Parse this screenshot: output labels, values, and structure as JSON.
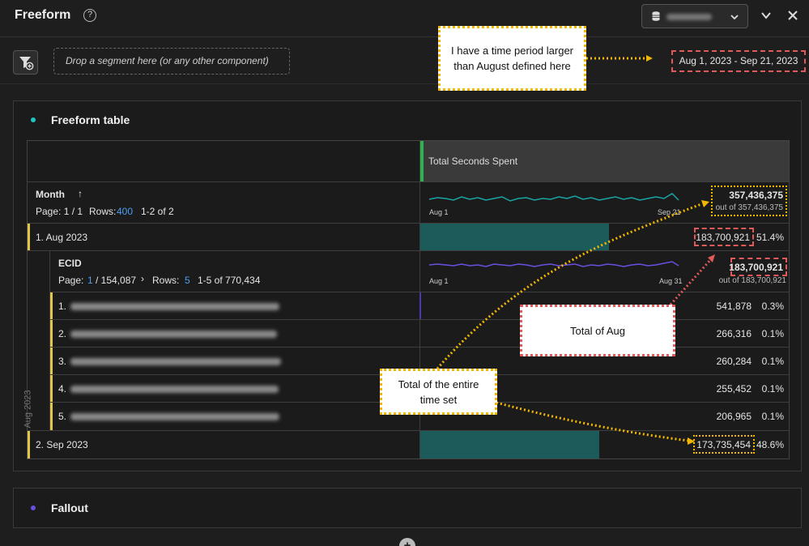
{
  "header": {
    "title": "Freeform",
    "help_icon": "?",
    "chevron_down": "⌄",
    "close": "✕"
  },
  "segment_bar": {
    "drop_placeholder": "Drop a segment here (or any other component)",
    "date_range": "Aug 1, 2023 - Sep 21, 2023"
  },
  "callouts": {
    "time_period": "I have a time period larger than August defined here",
    "total_aug": "Total of Aug",
    "total_entire": "Total of the entire time set"
  },
  "colors": {
    "accent_teal": "#21c3c3",
    "accent_purple": "#6b4fe0",
    "highlight_yellow": "#f2b700",
    "highlight_red": "#e05a5a"
  },
  "panel": {
    "title": "Freeform table",
    "metric_header": "Total Seconds Spent",
    "dimension": "Month",
    "sort_icon": "↑",
    "page_label": "Page: 1 / 1",
    "rows_label": "Rows:",
    "rows_value": "400",
    "range_label": "1-2 of 2",
    "spark_start": "Aug 1",
    "spark_end": "Sep 21",
    "grand_total": "357,436,375",
    "grand_total_sub": "out of 357,436,375",
    "aug_label": "1.  Aug 2023",
    "aug_value": "183,700,921",
    "aug_pct": "51.4%",
    "breakdown": {
      "dimension": "ECID",
      "page_prefix": "Page:",
      "page_current": "1",
      "page_total": "/ 154,087",
      "next_icon": "›",
      "rows_label": "Rows:",
      "rows_value": "5",
      "range_label": "1-5 of 770,434",
      "spark_start": "Aug 1",
      "spark_end": "Aug 31",
      "total": "183,700,921",
      "total_sub": "out of 183,700,921",
      "side_label": "Aug 2023",
      "rows": [
        {
          "idx": "1.",
          "value": "541,878",
          "pct": "0.3%"
        },
        {
          "idx": "2.",
          "value": "266,316",
          "pct": "0.1%"
        },
        {
          "idx": "3.",
          "value": "260,284",
          "pct": "0.1%"
        },
        {
          "idx": "4.",
          "value": "255,452",
          "pct": "0.1%"
        },
        {
          "idx": "5.",
          "value": "206,965",
          "pct": "0.1%"
        }
      ]
    },
    "sep_label": "2.  Sep 2023",
    "sep_value": "173,735,454",
    "sep_pct": "48.6%"
  },
  "fallout": {
    "title": "Fallout",
    "add_icon": "+"
  }
}
